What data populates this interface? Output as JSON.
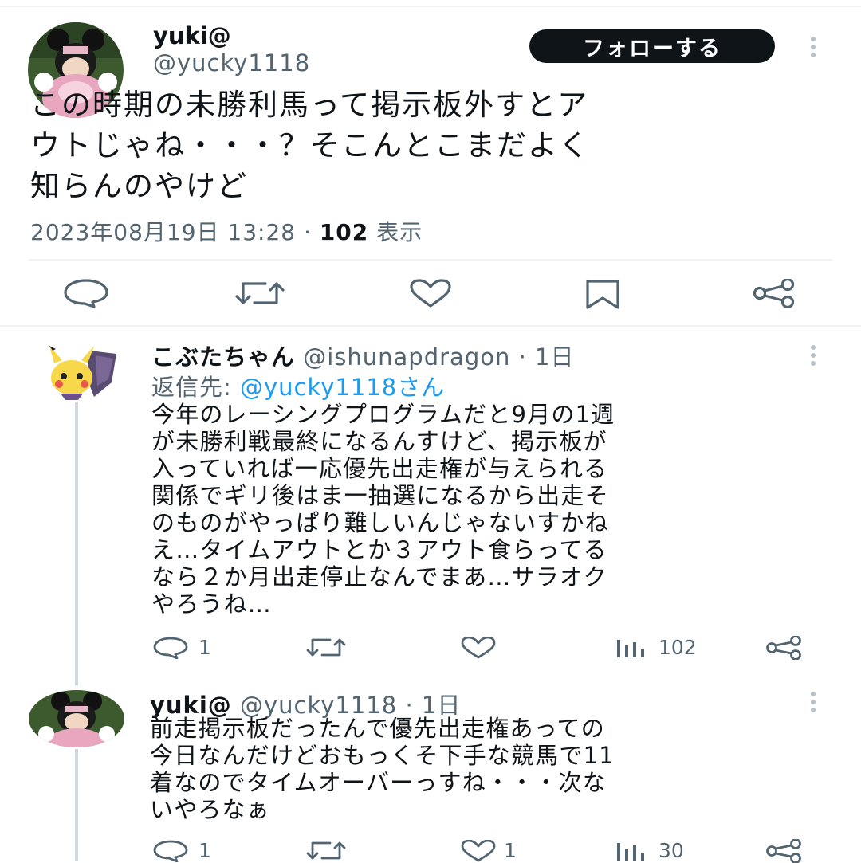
{
  "main_tweet": {
    "author_name": "yuki@",
    "author_handle": "@yucky1118",
    "follow_label": "フォローする",
    "text_lines": [
      "この時期の未勝利馬って掲示板外すとア",
      "ウトじゃね・・・？そこんとこまだよく",
      "知らんのやけど"
    ],
    "timestamp": "2023年08月19日 13:28",
    "separator": "·",
    "views_count": "102",
    "views_label": "表示",
    "actions": [
      "reply-icon",
      "retweet-icon",
      "like-icon",
      "bookmark-icon",
      "share-icon"
    ]
  },
  "replies": [
    {
      "author_name": "こぶたちゃん",
      "author_handle": "@ishunapdragon",
      "time": "· 1日",
      "reply_to_label": "返信先:",
      "reply_to_handle": "@yucky1118さん",
      "text_lines": [
        "今年のレーシングプログラムだと9月の1週",
        "が未勝利戦最終になるんすけど、掲示板が",
        "入っていれば一応優先出走権が与えられる",
        "関係でギリ後はま一抽選になるから出走そ",
        "のものがやっぱり難しいんじゃないすかね",
        "え…タイムアウトとか３アウト食らってる",
        "なら２か月出走停止なんでまあ…サラオク",
        "やろうね…"
      ],
      "reply_count": "1",
      "like_count": "",
      "views_count": "102"
    },
    {
      "author_name": "yuki@",
      "author_handle": "@yucky1118",
      "time": "· 1日",
      "text_lines": [
        "前走掲示板だったんで優先出走権あっての",
        "今日なんだけどおもっくそ下手な競馬で11",
        "着なのでタイムオーバーっすね・・・次な",
        "いやろなぁ"
      ],
      "reply_count": "1",
      "like_count": "1",
      "views_count": "30"
    }
  ],
  "colors": {
    "text": "#0f1419",
    "secondary": "#536471",
    "link": "#1d9bf0",
    "button_bg": "#0f1419",
    "divider": "#eff3f4"
  }
}
